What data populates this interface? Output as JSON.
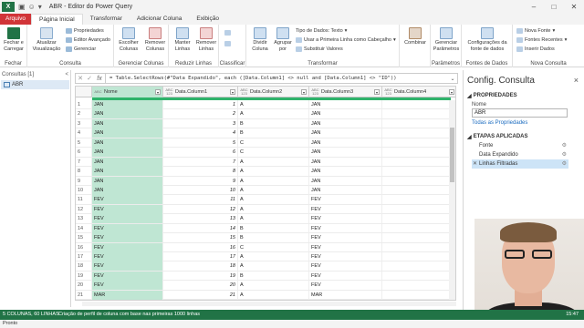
{
  "app": {
    "title": "ABR - Editor do Power Query",
    "logo": "X"
  },
  "tabs": [
    "Arquivo",
    "Página Inicial",
    "Transformar",
    "Adicionar Coluna",
    "Exibição"
  ],
  "ribbon": {
    "groups": [
      {
        "name": "Fechar",
        "buttons": [
          "Fechar e Carregar"
        ]
      },
      {
        "name": "Consulta",
        "buttons": [
          "Atualizar Visualização"
        ],
        "small": [
          "Propriedades",
          "Editor Avançado",
          "Gerenciar"
        ]
      },
      {
        "name": "Gerenciar Colunas",
        "buttons": [
          "Escolher Colunas",
          "Remover Colunas"
        ]
      },
      {
        "name": "Reduzir Linhas",
        "buttons": [
          "Manter Linhas",
          "Remover Linhas"
        ]
      },
      {
        "name": "Classificar",
        "buttons": []
      },
      {
        "name": "Transformar",
        "buttons": [
          "Dividir Coluna",
          "Agrupar por"
        ],
        "small": [
          "Tipo de Dados: Texto",
          "Usar a Primeira Linha como Cabeçalho",
          "Substituir Valores"
        ]
      },
      {
        "name": "",
        "buttons": [
          "Combinar"
        ]
      },
      {
        "name": "Parâmetros",
        "buttons": [
          "Gerenciar Parâmetros"
        ]
      },
      {
        "name": "Fontes de Dados",
        "buttons": [
          "Configurações da fonte de dados"
        ]
      },
      {
        "name": "Nova Consulta",
        "small": [
          "Nova Fonte",
          "Fontes Recentes",
          "Inserir Dados"
        ]
      }
    ]
  },
  "left_pane": {
    "header": "Consultas [1]",
    "collapse": "<",
    "items": [
      "ABR"
    ]
  },
  "formula": {
    "text": "= Table.SelectRows(#\"Data Expandido\", each ([Data.Column1] <> null and [Data.Column1] <> \"ID\"))",
    "fx": "fx"
  },
  "grid": {
    "columns": [
      {
        "type": "ABC",
        "name": "Nome"
      },
      {
        "type": "ABC 123",
        "name": "Data.Column1"
      },
      {
        "type": "ABC 123",
        "name": "Data.Column2"
      },
      {
        "type": "ABC 123",
        "name": "Data.Column3"
      },
      {
        "type": "ABC 123",
        "name": "Data.Column4"
      }
    ],
    "rows": [
      [
        "1",
        "JAN",
        "1",
        "A",
        "JAN"
      ],
      [
        "2",
        "JAN",
        "2",
        "A",
        "JAN"
      ],
      [
        "3",
        "JAN",
        "3",
        "B",
        "JAN"
      ],
      [
        "4",
        "JAN",
        "4",
        "B",
        "JAN"
      ],
      [
        "5",
        "JAN",
        "5",
        "C",
        "JAN"
      ],
      [
        "6",
        "JAN",
        "6",
        "C",
        "JAN"
      ],
      [
        "7",
        "JAN",
        "7",
        "A",
        "JAN"
      ],
      [
        "8",
        "JAN",
        "8",
        "A",
        "JAN"
      ],
      [
        "9",
        "JAN",
        "9",
        "A",
        "JAN"
      ],
      [
        "10",
        "JAN",
        "10",
        "A",
        "JAN"
      ],
      [
        "11",
        "FEV",
        "11",
        "A",
        "FEV"
      ],
      [
        "12",
        "FEV",
        "12",
        "A",
        "FEV"
      ],
      [
        "13",
        "FEV",
        "13",
        "A",
        "FEV"
      ],
      [
        "14",
        "FEV",
        "14",
        "B",
        "FEV"
      ],
      [
        "15",
        "FEV",
        "15",
        "B",
        "FEV"
      ],
      [
        "16",
        "FEV",
        "16",
        "C",
        "FEV"
      ],
      [
        "17",
        "FEV",
        "17",
        "A",
        "FEV"
      ],
      [
        "18",
        "FEV",
        "18",
        "A",
        "FEV"
      ],
      [
        "19",
        "FEV",
        "19",
        "B",
        "FEV"
      ],
      [
        "20",
        "FEV",
        "20",
        "A",
        "FEV"
      ],
      [
        "21",
        "MAR",
        "21",
        "A",
        "MAR"
      ],
      [
        "22",
        "MAR",
        "22",
        "A",
        "MAR"
      ]
    ]
  },
  "right_pane": {
    "title": "Config. Consulta",
    "close": "×",
    "properties_header": "PROPRIEDADES",
    "name_label": "Nome",
    "name_value": "ABR",
    "all_props_link": "Todas as Propriedades",
    "steps_header": "ETAPAS APLICADAS",
    "steps": [
      "Fonte",
      "Data Expandido",
      "Linhas Filtradas"
    ]
  },
  "status": {
    "left": "5 COLUNAS, 60 LINHAS",
    "middle": "Criação de perfil de coluna com base nas primeiras 1000 linhas",
    "right": "15:47"
  },
  "bottom": {
    "ready": "Pronto"
  },
  "colors": {
    "excel_green": "#217346",
    "file_tab": "#d13438",
    "selected_column": "#bfe6d3"
  }
}
